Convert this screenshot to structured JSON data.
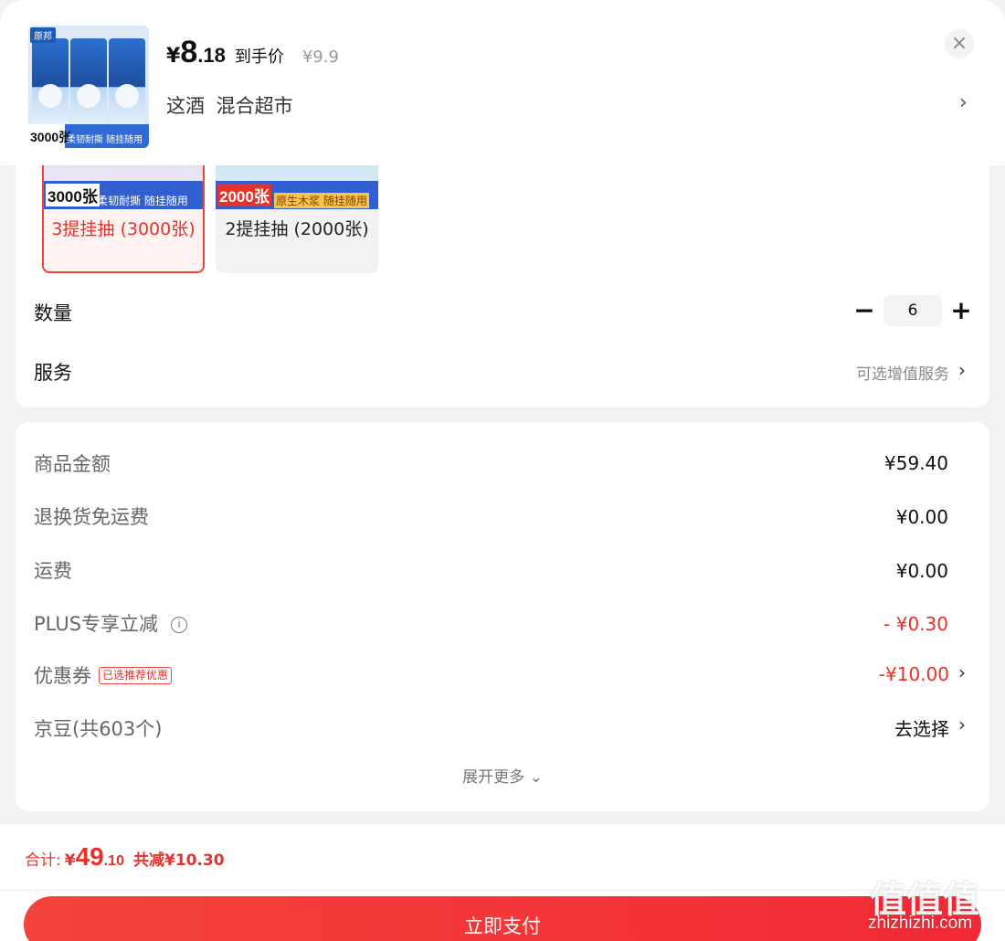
{
  "header": {
    "currency": "¥",
    "price_int": "8",
    "price_dec": ".18",
    "price_label": "到手价",
    "original_price": "¥9.9",
    "variant_text": "这酒 混合超市",
    "arrow": "›",
    "close": "×",
    "thumb_brand": "原邦",
    "thumb_count": "3000张",
    "thumb_tagline": "柔韧耐撕 随挂随用"
  },
  "options": [
    {
      "image_number": "3000张",
      "image_tag": "柔韧耐撕 随挂随用",
      "label": "3提挂抽 (3000张)",
      "selected": true
    },
    {
      "image_number": "2000张",
      "image_tag": "原生木浆 随挂随用",
      "label": "2提挂抽 (2000张)",
      "selected": false
    }
  ],
  "quantity": {
    "title": "数量",
    "minus": "−",
    "value": "6",
    "plus": "+"
  },
  "service": {
    "title": "服务",
    "value": "可选增值服务",
    "arrow": "›"
  },
  "fees": {
    "goods_amount": {
      "label": "商品金额",
      "value": "¥59.40"
    },
    "return_shipping": {
      "label": "退换货免运费",
      "value": "¥0.00"
    },
    "shipping": {
      "label": "运费",
      "value": "¥0.00"
    },
    "plus_discount": {
      "label": "PLUS专享立减",
      "info": "i",
      "value": "- ¥0.30"
    },
    "coupon": {
      "label": "优惠券",
      "badge": "已选推荐优惠",
      "value": "-¥10.00",
      "arrow": "›"
    },
    "jingdou": {
      "label": "京豆(共603个)",
      "value": "去选择",
      "arrow": "›"
    },
    "expand": "展开更多 ⌄"
  },
  "footer": {
    "total_label": "合计:",
    "total_currency": "¥",
    "total_int": "49",
    "total_dec": ".10",
    "total_saved": "共减¥10.30",
    "pay_button": "立即支付"
  },
  "watermark": {
    "glyphs": "值值值",
    "domain": "zhizhizhi.com"
  },
  "colors": {
    "accent_red": "#e5322b",
    "pay_button": "#f4423a",
    "background": "#f2f2f2"
  }
}
